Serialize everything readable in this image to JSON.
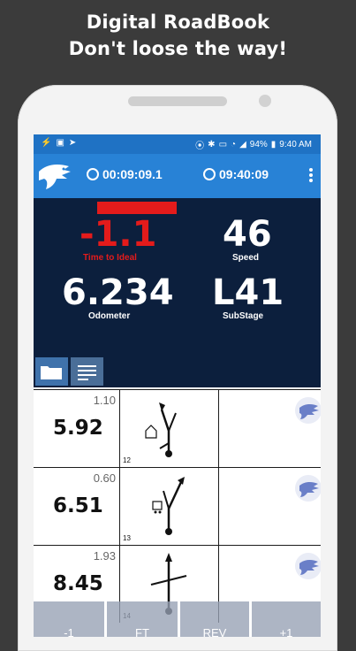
{
  "promo": {
    "line1": "Digital RoadBook",
    "line2": "Don't loose the way!"
  },
  "statusbar": {
    "left_icons": [
      "usb-icon",
      "image-icon",
      "send-icon"
    ],
    "right_icons": [
      "location-icon",
      "bluetooth-icon",
      "nfc-icon",
      "wifi-icon",
      "signal-icon",
      "battery-icon"
    ],
    "battery": "94%",
    "time": "9:40 AM"
  },
  "appbar": {
    "timer1": "00:09:09.1",
    "timer2": "09:40:09",
    "accent": "#2882d6"
  },
  "dashboard": {
    "time_to_ideal": "-1.1",
    "time_to_ideal_label": "Time to Ideal",
    "speed": "46",
    "speed_label": "Speed",
    "odometer": "6.234",
    "odometer_label": "Odometer",
    "substage": "L41",
    "substage_label": "SubStage",
    "alert_color": "#e41b1b"
  },
  "roadbook": {
    "rows": [
      {
        "distance": "5.92",
        "partial": "1.10",
        "number": "12"
      },
      {
        "distance": "6.51",
        "partial": "0.60",
        "number": "13"
      },
      {
        "distance": "8.45",
        "partial": "1.93",
        "number": "14"
      }
    ]
  },
  "bottombar": {
    "buttons": [
      "-1",
      "FT",
      "REV",
      "+1"
    ]
  }
}
